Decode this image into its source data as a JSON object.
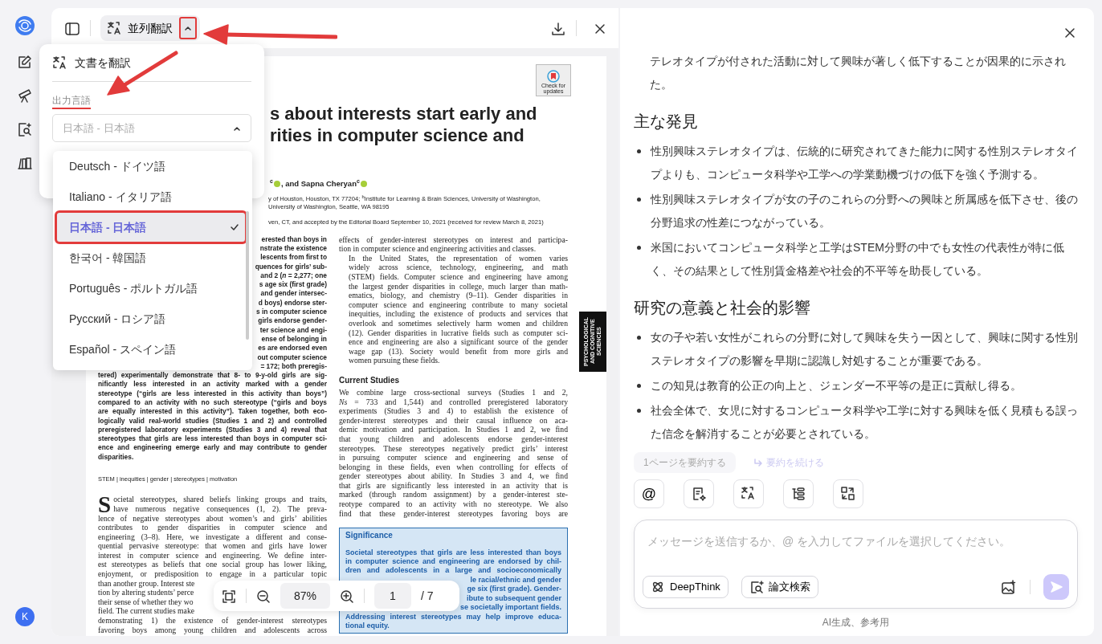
{
  "rail": {
    "avatar": "K"
  },
  "viewer": {
    "mode_label": "並列翻訳",
    "mode_menu_expanded": true,
    "menu": {
      "title": "文書を翻訳",
      "output_label": "出力言語",
      "select_value": "日本語 - 日本語",
      "list_open": true,
      "options": [
        {
          "label": "Deutsch - ドイツ語",
          "selected": false
        },
        {
          "label": "Italiano - イタリア語",
          "selected": false
        },
        {
          "label": "日本語 - 日本語",
          "selected": true
        },
        {
          "label": "한국어 - 韓国語",
          "selected": false
        },
        {
          "label": "Português - ポルトガル語",
          "selected": false
        },
        {
          "label": "Русский - ロシア語",
          "selected": false
        },
        {
          "label": "Español - スペイン語",
          "selected": false
        }
      ]
    },
    "page": {
      "badge": "Check for updates",
      "title_lines": [
        "s about interests start early and",
        "rities in computer science and"
      ],
      "authors": [
        "$^{c}$",
        ", and Sapna Cheryan$^{c}$"
      ],
      "affiliations": [
        "y of Houston, Houston, TX 77204; $^{b}$Institute for Learning & Brain Sciences, University of Washington,",
        "University of Washington, Seattle, WA 98195"
      ],
      "edited": "ven, CT, and accepted by the Editorial Board September 10, 2021 (received for review March 8, 2021)",
      "abstract_visible_ends": [
        "erested than boys in",
        "nstrate the existence",
        "lescents from first to",
        "quences for girls’ sub-",
        "and 2 (*n* = 2,277; one",
        "s age six (first grade)",
        "and gender intersec-",
        "d boys) endorse ster-",
        "s in computer science",
        "girls endorse gender-",
        "ter science and engi-",
        "ense of belonging in",
        "es are endorsed even",
        "out computer science",
        "= 172; both preregis-"
      ],
      "abstract_lines": [
        "tered) experimentally demonstrate that 8- to 9-y-old girls are sig-",
        "nificantly less interested in an activity marked with a gender",
        "stereotype (“girls are less interested in this activity than boys”)",
        "compared to an activity with no such stereotype (“girls and boys",
        "are equally interested in this activity”). Taken together, both eco-",
        "logically valid real-world studies (Studies 1 and 2) and controlled",
        "preregistered laboratory experiments (Studies 3 and 4) reveal that",
        "stereotypes that girls are less interested than boys in computer sci-",
        "ence and engineering emerge early and may contribute to gender",
        "disparities."
      ],
      "keywords": "STEM | inequities | gender | stereotypes | motivation",
      "drop_cap": "S",
      "body_left": {
        "lines": [
          "ocietal stereotypes, shared beliefs linking groups and traits,",
          "have numerous negative consequences (1, 2). The preva-",
          "lence of negative stereotypes about women’s and girls’ abilities",
          "contributes to gender disparities in computer science and",
          "engineering (3–8). Here, we investigate a different and conse-",
          "quential pervasive stereotype: that women and girls have lower",
          "interest in computer science and engineering. We define inter-",
          "est stereotypes as beliefs that one social group has lower liking,",
          "enjoyment, or predisposition to engage in a particular topic"
        ],
        "hidden_tail_lines": [
          "than another group. Interest ste",
          "tion by altering students’ perce",
          "their sense of whether they wo",
          "field. The current studies make"
        ],
        "lines_after": [
          "demonstrating 1) the existence of gender-interest stereotypes",
          "favoring boys among young children and adolescents across"
        ]
      },
      "body_right": [
        {
          "indent": false,
          "continues": false,
          "lines": [
            "effects of gender-interest stereotypes on interest and participa-",
            "tion in computer science and engineering activities and classes."
          ]
        },
        {
          "indent": true,
          "continues": false,
          "lines": [
            "In the United States, the representation of women varies",
            "widely across science, technology, engineering, and math",
            "(STEM) fields. Computer science and engineering have among",
            "the largest gender disparities in college, much larger than math-",
            "ematics, biology, and chemistry (9–11). Gender disparities in",
            "computer science and engineering contribute to many societal",
            "inequities, including the existence of products and services that",
            "overlook and sometimes selectively harm women and children",
            "(12). Gender disparities in lucrative fields such as computer sci-",
            "ence and engineering are also a significant source of the gender",
            "wage gap (13). Society would benefit from more girls and",
            "women pursuing these fields."
          ]
        }
      ],
      "current_heading": "Current Studies",
      "current": {
        "indent": false,
        "continues": true,
        "lines": [
          "We combine large cross-sectional surveys (Studies 1 and 2,",
          "*Ns* = 733 and 1,544) and controlled preregistered laboratory",
          "experiments (Studies 3 and 4) to establish the existence of",
          "gender-interest stereotypes and their causal influence on aca-",
          "demic motivation and participation. In Studies 1 and 2, we find",
          "that young children and adolescents endorse gender-interest",
          "stereotypes. These stereotypes negatively predict girls’ interest",
          "in pursuing computer science and engineering and sense of",
          "belonging in these fields, even when controlling for effects of",
          "gender stereotypes about ability. In Studies 3 and 4, we find",
          "that girls are significantly less interested in an activity that is",
          "marked (through random assignment) by a gender-interest ste-",
          "reotype compared to an activity with no stereotype. We also",
          "find that these gender-interest stereotypes favoring boys are"
        ]
      },
      "section_tab": "PSYCHOLOGICAL AND COGNITIVE SCIENCES",
      "significance": {
        "title": "Significance",
        "lines": [
          "Societal stereotypes that girls are less interested than boys",
          "in computer science and engineering are endorsed by chil-",
          "dren and adolescents in a large and socioeconomically"
        ],
        "hidden_head_lines": [
          "le racial/ethnic and gender",
          "ge six (first grade). Gender-",
          "ibute to subsequent gender",
          "se societally important fields."
        ],
        "lines_after": [
          "Addressing interest stereotypes may help improve educa-",
          "tional equity."
        ]
      }
    },
    "zoom_bar": {
      "zoom": "87%",
      "page": "1",
      "total": "/ 7"
    }
  },
  "chat": {
    "summary_tail": "テレオタイプが付された活動に対して興味が著しく低下することが因果的に示された。",
    "sections": [
      {
        "heading": "主な発見",
        "bullets": [
          "性別興味ステレオタイプは、伝統的に研究されてきた能力に関する性別ステレオタイプよりも、コンピュータ科学や工学への学業動機づけの低下を強く予測する。",
          "性別興味ステレオタイプが女の子のこれらの分野への興味と所属感を低下させ、後の分野追求の性差につながっている。",
          "米国においてコンピュータ科学と工学はSTEM分野の中でも女性の代表性が特に低く、その結果として性別賃金格差や社会的不平等を助長している。"
        ]
      },
      {
        "heading": "研究の意義と社会的影響",
        "bullets": [
          "女の子や若い女性がこれらの分野に対して興味を失う一因として、興味に関する性別ステレオタイプの影響を早期に認識し対処することが重要である。",
          "この知見は教育的公正の向上と、ジェンダー不平等の是正に貢献し得る。",
          "社会全体で、女児に対するコンピュータ科学や工学に対する興味を低く見積もる誤った信念を解消することが必要とされている。"
        ]
      }
    ],
    "suggestions": [
      {
        "kind": "chip",
        "label": "1ページを要約する"
      },
      {
        "kind": "link",
        "label": "要約を続ける"
      }
    ],
    "tools": [
      {
        "kind": "mention",
        "label": "@"
      },
      {
        "kind": "summary"
      },
      {
        "kind": "translate"
      },
      {
        "kind": "outline"
      },
      {
        "kind": "convert"
      }
    ],
    "input": {
      "placeholder": "メッセージを送信するか、@ を入力してファイルを選択してください。"
    },
    "modes": [
      {
        "kind": "deepthink",
        "label": "DeepThink"
      },
      {
        "kind": "papers",
        "label": "論文検索"
      }
    ],
    "send_enabled": false,
    "footer": "AI生成、参考用"
  }
}
